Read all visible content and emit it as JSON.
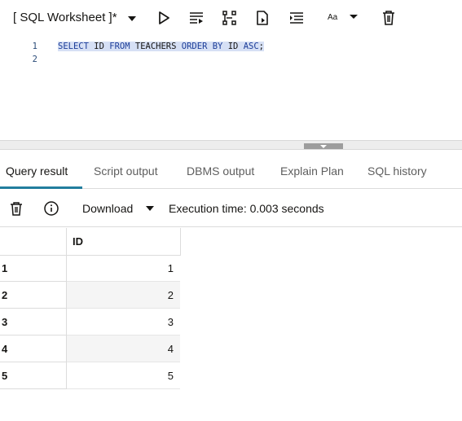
{
  "toolbar": {
    "worksheet_title": "[ SQL Worksheet ]*",
    "font_label": "Aa",
    "icons": [
      "chevron-down-icon",
      "run-icon",
      "run-script-icon",
      "explain-plan-icon",
      "autotrace-icon",
      "format-icon",
      "font-size-icon",
      "delete-icon"
    ]
  },
  "editor": {
    "line_numbers": [
      "1",
      "2"
    ],
    "tokens": [
      {
        "t": "SELECT",
        "kw": true
      },
      {
        "t": " "
      },
      {
        "t": "ID",
        "kw": false
      },
      {
        "t": " "
      },
      {
        "t": "FROM",
        "kw": true
      },
      {
        "t": " "
      },
      {
        "t": "TEACHERS",
        "kw": false
      },
      {
        "t": " "
      },
      {
        "t": "ORDER",
        "kw": true
      },
      {
        "t": " "
      },
      {
        "t": "BY",
        "kw": true
      },
      {
        "t": " "
      },
      {
        "t": "ID",
        "kw": false
      },
      {
        "t": " "
      },
      {
        "t": "ASC",
        "kw": true
      },
      {
        "t": ";",
        "kw": false
      }
    ]
  },
  "tabs": [
    {
      "label": "Query result",
      "active": true
    },
    {
      "label": "Script output",
      "active": false
    },
    {
      "label": "DBMS output",
      "active": false
    },
    {
      "label": "Explain Plan",
      "active": false
    },
    {
      "label": "SQL history",
      "active": false
    }
  ],
  "result_toolbar": {
    "download_label": "Download",
    "execution_time": "Execution time: 0.003 seconds"
  },
  "grid": {
    "columns": [
      "ID"
    ],
    "rows": [
      {
        "index": "1",
        "id": "1"
      },
      {
        "index": "2",
        "id": "2"
      },
      {
        "index": "3",
        "id": "3"
      },
      {
        "index": "4",
        "id": "4"
      },
      {
        "index": "5",
        "id": "5"
      }
    ]
  },
  "colors": {
    "accent": "#227e9e",
    "keyword": "#1c3d98",
    "selection": "#d6e0f5"
  }
}
